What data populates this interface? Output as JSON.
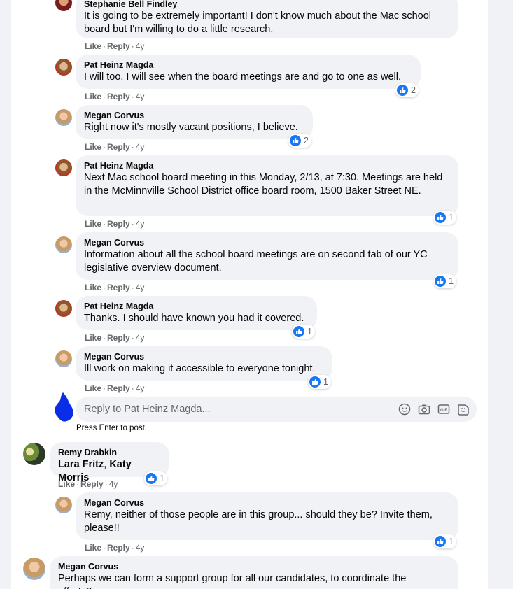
{
  "comments": [
    {
      "name": "Stephanie Bell Findley",
      "text": "It is going to be extremely important! I don't know much about the Mac school board but I'm willing to do a little research.",
      "like": "Like",
      "reply": "Reply",
      "time": "4y"
    },
    {
      "name": "Pat Heinz Magda",
      "text": "I will too. I will see when the board meetings are and go to one as well.",
      "like": "Like",
      "reply": "Reply",
      "time": "4y",
      "reactions": "2"
    },
    {
      "name": "Megan Corvus",
      "text": "Right now it's mostly vacant positions, I believe.",
      "like": "Like",
      "reply": "Reply",
      "time": "4y",
      "reactions": "2"
    },
    {
      "name": "Pat Heinz Magda",
      "text": "Next Mac school board meeting in this Monday, 2/13, at 7:30. Meetings are held in the McMinnville School District office board room, 1500 Baker Street NE.",
      "like": "Like",
      "reply": "Reply",
      "time": "4y",
      "reactions": "1"
    },
    {
      "name": "Megan Corvus",
      "text": "Information about all the school board meetings are on second tab of our YC legislative overview document.",
      "like": "Like",
      "reply": "Reply",
      "time": "4y",
      "reactions": "1"
    },
    {
      "name": "Pat Heinz Magda",
      "text": "Thanks. I should have known you had it covered.",
      "like": "Like",
      "reply": "Reply",
      "time": "4y",
      "reactions": "1"
    },
    {
      "name": "Megan Corvus",
      "text": "Ill work on making it accessible to everyone tonight.",
      "like": "Like",
      "reply": "Reply",
      "time": "4y",
      "reactions": "1"
    }
  ],
  "reply_box": {
    "placeholder": "Reply to Pat Heinz Magda...",
    "hint": "Press Enter to post."
  },
  "remy": {
    "name": "Remy Drabkin",
    "mention1": "Lara Fritz",
    "comma": ",",
    "mention2": "Katy Morris",
    "like": "Like",
    "reply": "Reply",
    "time": "4y",
    "reactions": "1"
  },
  "megan_reply": {
    "name": "Megan Corvus",
    "text": "Remy, neither of those people are in this group... should they be? Invite them, please!!",
    "like": "Like",
    "reply": "Reply",
    "time": "4y",
    "reactions": "1"
  },
  "last": {
    "name": "Megan Corvus",
    "text": "Perhaps we can form a support group for all our candidates, to coordinate the efforts?"
  },
  "colors": {
    "like_blue": "#1877f2",
    "bubble": "#f0f2f5",
    "meta": "#65676b",
    "scribble": "#0a2ee8"
  }
}
